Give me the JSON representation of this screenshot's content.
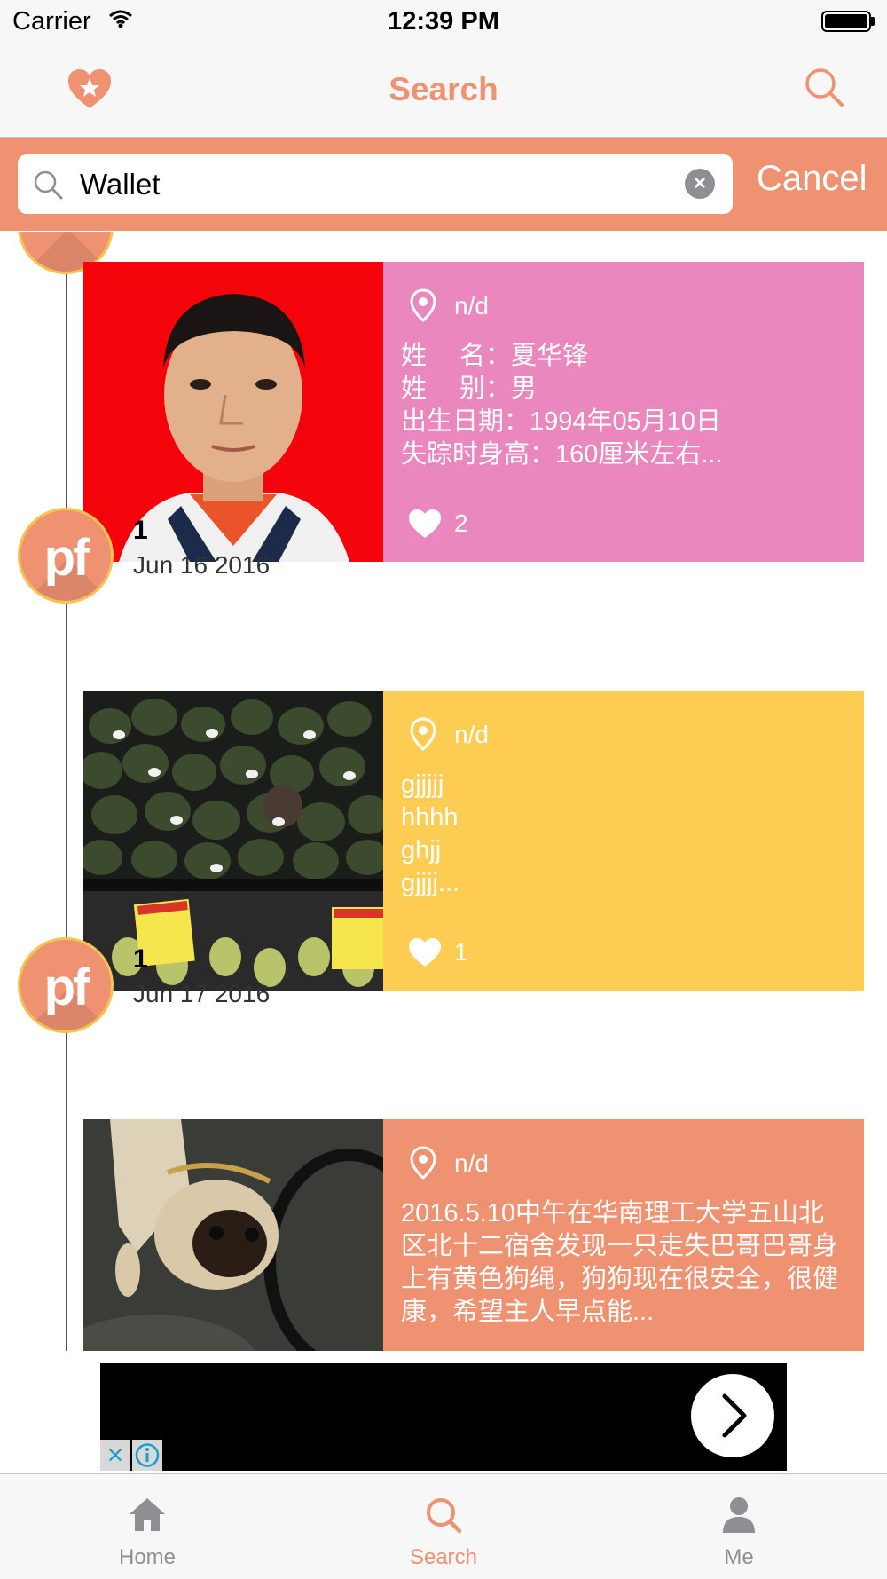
{
  "status_bar": {
    "carrier": "Carrier",
    "time": "12:39 PM"
  },
  "nav": {
    "title": "Search",
    "left_icon": "heart-star-icon",
    "right_icon": "search-icon"
  },
  "search": {
    "value": "Wallet",
    "placeholder": "",
    "cancel_label": "Cancel"
  },
  "posts": [
    {
      "location": "n/d",
      "description": "姓　 名：夏华锋\n姓　 别：男\n出生日期：1994年05月10日\n失踪时身高：160厘米左右...",
      "likes": "2",
      "card_color": "#e987be"
    },
    {
      "author": "1",
      "avatar_text": "pf",
      "date": "Jun 16 2016",
      "location": "n/d",
      "description": "gjjjjj\nhhhh\nghjj\ngjjjj...",
      "likes": "1",
      "card_color": "#fdcd53"
    },
    {
      "author": "1",
      "avatar_text": "pf",
      "date": "Jun 17 2016",
      "location": "n/d",
      "description": "2016.5.10中午在华南理工大学五山北区北十二宿舍发现一只走失巴哥巴哥身上有黄色狗绳，狗狗现在很安全，很健康，希望主人早点能...",
      "card_color": "#ef9272"
    }
  ],
  "tabs": [
    {
      "label": "Home",
      "icon": "home-icon",
      "active": false
    },
    {
      "label": "Search",
      "icon": "search-icon",
      "active": true
    },
    {
      "label": "Me",
      "icon": "person-icon",
      "active": false
    }
  ],
  "colors": {
    "accent": "#ef9272",
    "tab_inactive": "#8e8e93",
    "avatar_ring": "#f5c34f"
  }
}
